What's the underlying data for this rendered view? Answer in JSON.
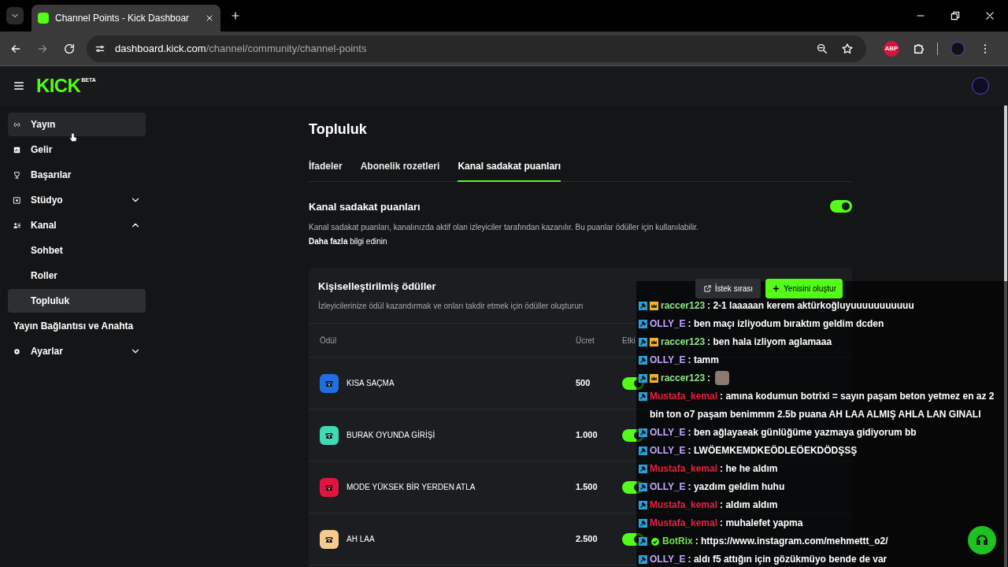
{
  "browser": {
    "tab_title": "Channel Points - Kick Dashboar",
    "url_host": "dashboard.kick.com",
    "url_path": "/channel/community/channel-points",
    "extension_label": "ABP"
  },
  "header": {
    "logo": "KICK",
    "logo_badge": "BETA"
  },
  "sidebar": {
    "items": [
      {
        "label": "Yayın",
        "selected": false,
        "hovered": true
      },
      {
        "label": "Gelir",
        "selected": false,
        "hovered": false
      },
      {
        "label": "Başarılar",
        "selected": false,
        "hovered": false
      },
      {
        "label": "Stüdyo",
        "selected": false,
        "hovered": false,
        "expanded": false
      },
      {
        "label": "Kanal",
        "selected": false,
        "hovered": false,
        "expanded": true,
        "children": [
          {
            "label": "Sohbet",
            "kind": "sub",
            "selected": false
          },
          {
            "label": "Roller",
            "kind": "sub",
            "selected": false
          },
          {
            "label": "Topluluk",
            "kind": "sub",
            "selected": true
          },
          {
            "label": "Yayın Bağlantısı ve Anahta",
            "kind": "wide",
            "selected": false
          }
        ]
      },
      {
        "label": "Ayarlar",
        "selected": false,
        "hovered": false,
        "expanded": false
      }
    ]
  },
  "page": {
    "title": "Topluluk",
    "tabs": [
      {
        "label": "İfadeler",
        "selected": false
      },
      {
        "label": "Abonelik rozetleri",
        "selected": false
      },
      {
        "label": "Kanal sadakat puanları",
        "selected": true
      }
    ],
    "section": {
      "title": "Kanal sadakat puanları",
      "on": true,
      "description": "Kanal sadakat puanları, kanalınızda aktif olan izleyiciler tarafından kazanılır. Bu puanlar ödüller için kullanılabilir.",
      "link": "**Daha fazla** bilgi edinin"
    },
    "rewards": {
      "title": "Kişiselleştirilmiş ödüller",
      "subtitle": "İzleyicilerinize ödül kazandırmak ve onları takdir etmek için ödüller oluşturun",
      "queue_button": "İstek sırası",
      "create_button": "Yenisini oluştur",
      "columns": [
        "Ödül",
        "Ücret",
        "Etki"
      ],
      "rows": [
        {
          "name": "KISA SAÇMA",
          "cost": "500",
          "color": "#1f6fe0",
          "enabled": true
        },
        {
          "name": "BURAK OYUNDA GİRİŞİ",
          "cost": "1.000",
          "color": "#3fd9b4",
          "enabled": true
        },
        {
          "name": "MODE YÜKSEK BİR YERDEN ATLA",
          "cost": "1.500",
          "color": "#e0163f",
          "enabled": true
        },
        {
          "name": "AH LAA",
          "cost": "2.500",
          "color": "#f6c98e",
          "enabled": true
        }
      ]
    }
  },
  "chat": {
    "messages": [
      {
        "user": "raccer123",
        "color": "#8fe38a",
        "crown": true,
        "verified": false,
        "text": ": 2-1 laaaaan kerem aktürkoğluyuuuuuuuuuuu"
      },
      {
        "user": "OLLY_E",
        "color": "#c3a4ff",
        "crown": false,
        "verified": false,
        "text": ": ben maçı izliyodum bıraktım geldim dcden"
      },
      {
        "user": "raccer123",
        "color": "#8fe38a",
        "crown": true,
        "verified": false,
        "text": ": ben hala izliyom aglamaaa"
      },
      {
        "user": "OLLY_E",
        "color": "#c3a4ff",
        "crown": false,
        "verified": false,
        "text": ": tamm"
      },
      {
        "user": "raccer123",
        "color": "#8fe38a",
        "crown": true,
        "verified": false,
        "text": ":",
        "emote": true
      },
      {
        "user": "Mustafa_kemal",
        "color": "#e5223f",
        "crown": false,
        "verified": false,
        "text": ": amına kodumun botrixi = sayın paşam beton yetmez en az 2 bin ton o7 paşam benimmm 2.5b puana AH LAA ALMIŞ AHLA LAN GINALI"
      },
      {
        "user": "OLLY_E",
        "color": "#c3a4ff",
        "crown": false,
        "verified": false,
        "text": ": ben ağlayaeak günlüğüme yazmaya gidiyorum bb"
      },
      {
        "user": "OLLY_E",
        "color": "#c3a4ff",
        "crown": false,
        "verified": false,
        "text": ": LWÖEMKEMDKEÖDLEÖEKDÖDŞSŞ"
      },
      {
        "user": "Mustafa_kemal",
        "color": "#e5223f",
        "crown": false,
        "verified": false,
        "text": ": he he aldım"
      },
      {
        "user": "OLLY_E",
        "color": "#c3a4ff",
        "crown": false,
        "verified": false,
        "text": ": yazdım geldim huhu"
      },
      {
        "user": "Mustafa_kemal",
        "color": "#e5223f",
        "crown": false,
        "verified": false,
        "text": ": aldım aldım"
      },
      {
        "user": "Mustafa_kemal",
        "color": "#e5223f",
        "crown": false,
        "verified": false,
        "text": ": muhalefet yapma"
      },
      {
        "user": "BotRix",
        "color": "#6fe04c",
        "crown": false,
        "verified": true,
        "text": ": https://www.instagram.com/mehmettt_o2/"
      },
      {
        "user": "OLLY_E",
        "color": "#c3a4ff",
        "crown": false,
        "verified": false,
        "text": ": aldı f5 attığın için gözükmüyo bende de var"
      }
    ]
  }
}
